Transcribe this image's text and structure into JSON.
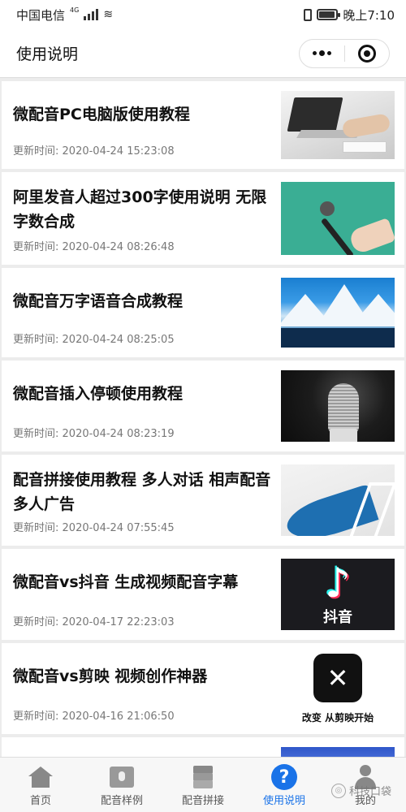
{
  "status": {
    "carrier": "中国电信",
    "network": "4G",
    "time": "晚上7:10",
    "battery_level": 0.85
  },
  "header": {
    "title": "使用说明",
    "more_icon": "more-dots-icon",
    "close_icon": "target-circle-icon"
  },
  "articles": [
    {
      "title": "微配音PC电脑版使用教程",
      "meta_label": "更新时间:",
      "date": "2020-04-24 15:23:08",
      "thumb": "laptop-typing-image"
    },
    {
      "title": "阿里发音人超过300字使用说明 无限字数合成",
      "meta_label": "更新时间:",
      "date": "2020-04-24 08:26:48",
      "thumb": "hand-microphone-image"
    },
    {
      "title": "微配音万字语音合成教程",
      "meta_label": "更新时间:",
      "date": "2020-04-24 08:25:05",
      "thumb": "snowy-mountains-image"
    },
    {
      "title": "微配音插入停顿使用教程",
      "meta_label": "更新时间:",
      "date": "2020-04-24 08:23:19",
      "thumb": "studio-microphone-image"
    },
    {
      "title": "配音拼接使用教程 多人对话 相声配音 多人广告",
      "meta_label": "更新时间:",
      "date": "2020-04-24 07:55:45",
      "thumb": "abstract-blue-image"
    },
    {
      "title": "微配音vs抖音 生成视频配音字幕",
      "meta_label": "更新时间:",
      "date": "2020-04-17 22:23:03",
      "thumb": "tiktok-logo-image",
      "thumb_caption": "抖音"
    },
    {
      "title": "微配音vs剪映 视频创作神器",
      "meta_label": "更新时间:",
      "date": "2020-04-16 21:06:50",
      "thumb": "capcut-logo-image",
      "thumb_caption": "改变 从剪映开始"
    }
  ],
  "tabs": [
    {
      "label": "首页",
      "icon": "home-icon",
      "active": false
    },
    {
      "label": "配音样例",
      "icon": "sample-icon",
      "active": false
    },
    {
      "label": "配音拼接",
      "icon": "layers-icon",
      "active": false
    },
    {
      "label": "使用说明",
      "icon": "help-icon",
      "active": true
    },
    {
      "label": "我的",
      "icon": "user-icon",
      "active": false
    }
  ],
  "watermark": "科技口袋",
  "colors": {
    "accent": "#1a73e8",
    "background": "#ececec"
  }
}
